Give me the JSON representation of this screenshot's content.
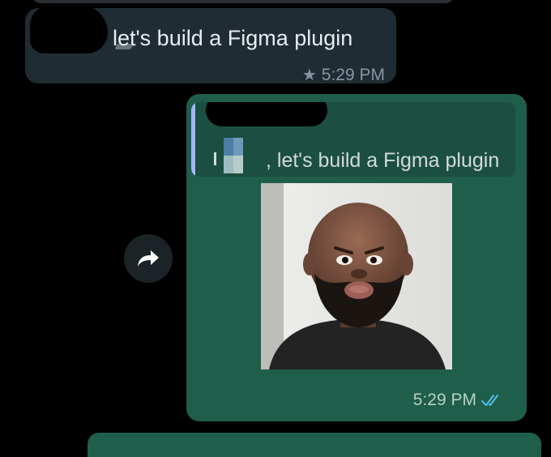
{
  "incoming": {
    "text": "let's build a Figma plugin",
    "time": "5:29 PM",
    "starred": true
  },
  "outgoing": {
    "quote_text": ", let's build a Figma plugin",
    "time": "5:29 PM",
    "read_status": "read"
  },
  "colors": {
    "incoming_bubble": "#1f2c34",
    "outgoing_bubble": "#1e5e4b",
    "quote_bar": "#a5b4fc",
    "read_ticks": "#53bdeb"
  },
  "icons": {
    "star": "star-icon",
    "ticks": "double-check-icon",
    "forward": "forward-arrow-icon"
  }
}
